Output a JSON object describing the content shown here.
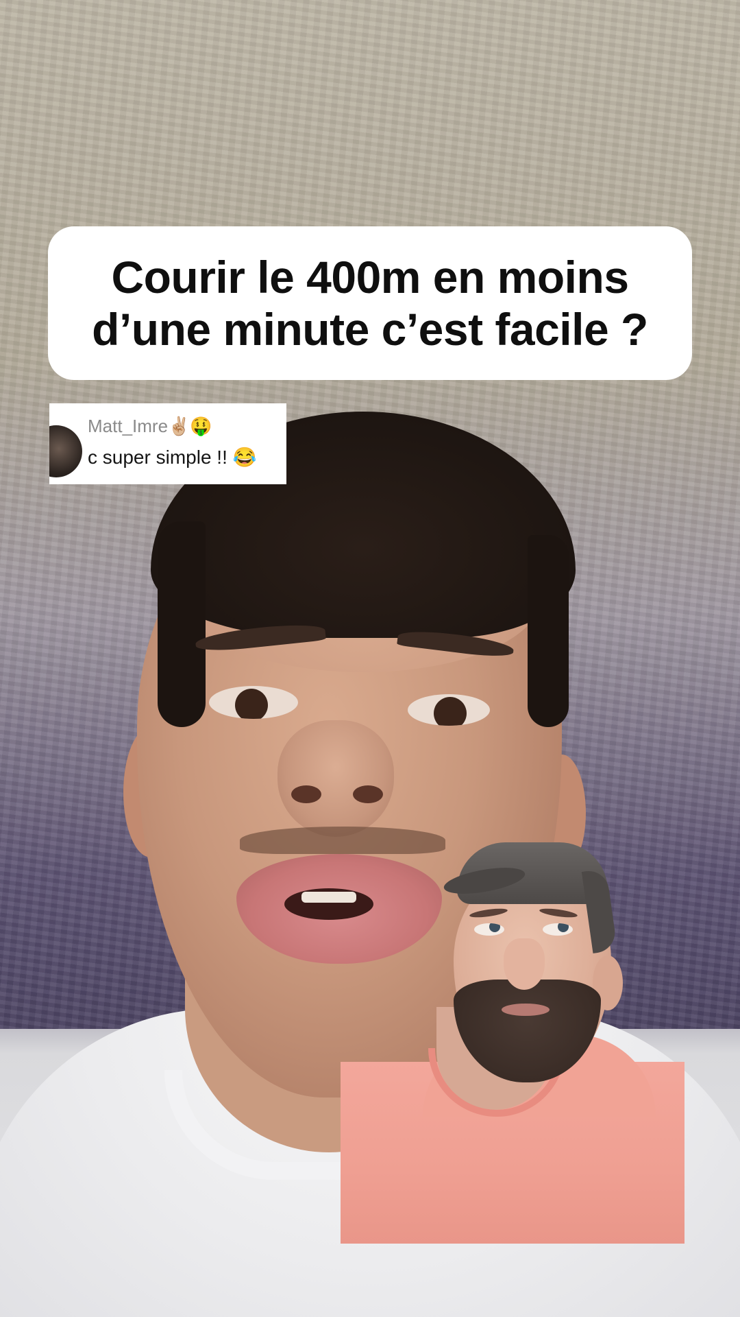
{
  "video": {
    "caption": "Courir le 400m en moins d’une minute c’est facile ?",
    "caption_line1": "Courir le 400m en moins",
    "caption_line2": "d’une minute c’est facile ?"
  },
  "reply_comment": {
    "username": "Matt_Imre✌🏼🤑",
    "text": "c super simple !! 😂",
    "avatar_icon": "user-avatar"
  },
  "overlay": {
    "pip_description_icon": "green-screen-person"
  },
  "colors": {
    "caption_bg": "#ffffff",
    "caption_text": "#0f0f0f",
    "username_gray": "#8a8a8a",
    "pip_shirt_pink": "#f1a395"
  }
}
